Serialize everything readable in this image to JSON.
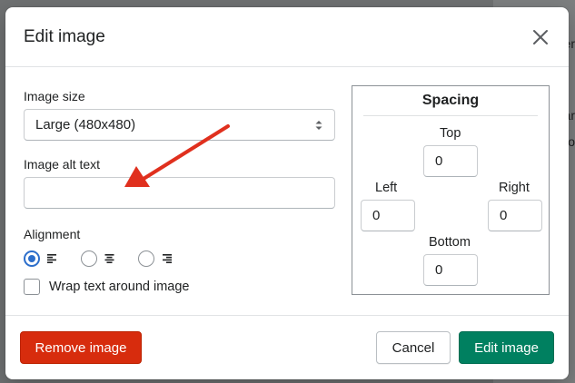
{
  "background": {
    "fragments": [
      "er",
      "ar",
      "o"
    ]
  },
  "dialog": {
    "title": "Edit image",
    "close_icon": "close-icon"
  },
  "form": {
    "image_size_label": "Image size",
    "image_size_value": "Large (480x480)",
    "alt_text_label": "Image alt text",
    "alt_text_value": "",
    "alignment_label": "Alignment",
    "alignment_options": [
      "left",
      "center",
      "right"
    ],
    "alignment_selected": "left",
    "wrap_label": "Wrap text around image",
    "wrap_checked": false
  },
  "spacing": {
    "title": "Spacing",
    "top_label": "Top",
    "top_value": "0",
    "left_label": "Left",
    "left_value": "0",
    "right_label": "Right",
    "right_value": "0",
    "bottom_label": "Bottom",
    "bottom_value": "0"
  },
  "footer": {
    "remove_label": "Remove image",
    "cancel_label": "Cancel",
    "edit_label": "Edit image"
  },
  "colors": {
    "accent_red": "#d72c0d",
    "accent_green": "#008060",
    "radio_blue": "#2c6ecb",
    "annotation_arrow": "#e0301e"
  }
}
